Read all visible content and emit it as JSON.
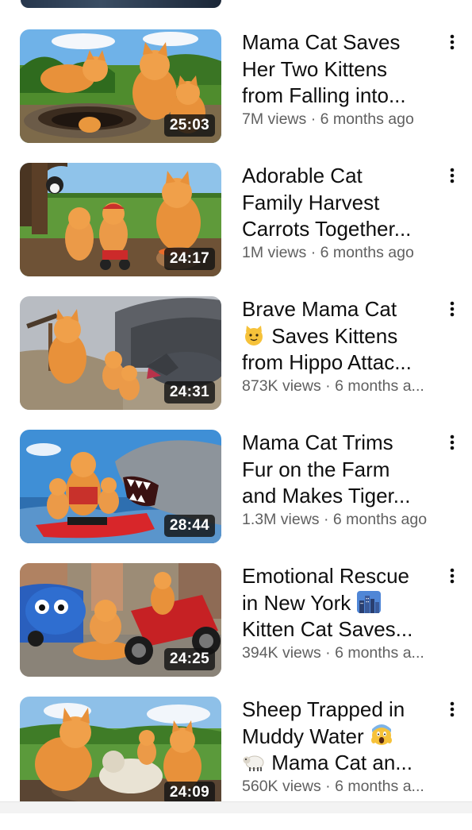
{
  "videos": [
    {
      "title_lines": [
        "Mama Cat Saves",
        "Her Two Kittens",
        "from Falling into..."
      ],
      "views": "7M views",
      "age": "6 months ago",
      "duration": "25:03",
      "scene": "well"
    },
    {
      "title_lines": [
        "Adorable Cat",
        "Family Harvest",
        "Carrots Together..."
      ],
      "views": "1M views",
      "age": "6 months ago",
      "duration": "24:17",
      "scene": "farm"
    },
    {
      "title_lines": [
        "Brave Mama Cat",
        "Saves Kittens",
        "from Hippo Attac..."
      ],
      "emoji_before_line2": "cat-face-emoji",
      "views": "873K views",
      "age": "6 months a...",
      "duration": "24:31",
      "scene": "quarry"
    },
    {
      "title_lines": [
        "Mama Cat Trims",
        "Fur on the Farm",
        "and Makes Tiger..."
      ],
      "views": "1.3M views",
      "age": "6 months ago",
      "duration": "28:44",
      "scene": "shark"
    },
    {
      "title_lines": [
        "Emotional Rescue",
        "in New York",
        "Kitten Cat Saves..."
      ],
      "emoji_after_line2": "city-skyline-emoji",
      "views": "394K views",
      "age": "6 months a...",
      "duration": "24:25",
      "scene": "street"
    },
    {
      "title_lines": [
        "Sheep Trapped in",
        "Muddy Water",
        "Mama Cat an..."
      ],
      "emoji_after_line2": "screaming-face-emoji",
      "emoji_before_line3": "sheep-emoji",
      "views": "560K views",
      "age": "6 months a...",
      "duration": "24:09",
      "scene": "mud"
    }
  ],
  "meta_separator": "·",
  "icons": {
    "more": "more-vertical-icon"
  },
  "colors": {
    "title": "#0f0f0f",
    "meta": "#606060",
    "duration_bg": "#141414"
  }
}
